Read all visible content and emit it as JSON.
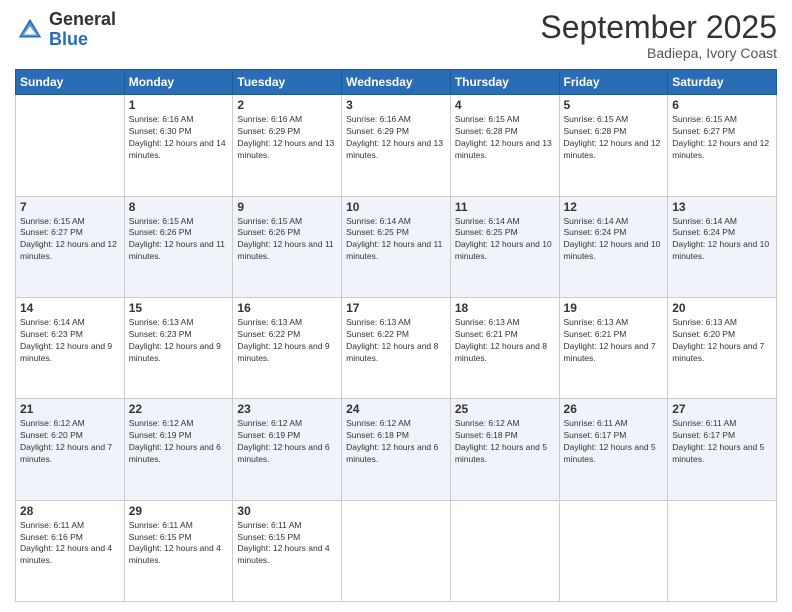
{
  "logo": {
    "general": "General",
    "blue": "Blue"
  },
  "header": {
    "month": "September 2025",
    "location": "Badiepa, Ivory Coast"
  },
  "days_of_week": [
    "Sunday",
    "Monday",
    "Tuesday",
    "Wednesday",
    "Thursday",
    "Friday",
    "Saturday"
  ],
  "weeks": [
    [
      {
        "day": "",
        "sunrise": "",
        "sunset": "",
        "daylight": ""
      },
      {
        "day": "1",
        "sunrise": "Sunrise: 6:16 AM",
        "sunset": "Sunset: 6:30 PM",
        "daylight": "Daylight: 12 hours and 14 minutes."
      },
      {
        "day": "2",
        "sunrise": "Sunrise: 6:16 AM",
        "sunset": "Sunset: 6:29 PM",
        "daylight": "Daylight: 12 hours and 13 minutes."
      },
      {
        "day": "3",
        "sunrise": "Sunrise: 6:16 AM",
        "sunset": "Sunset: 6:29 PM",
        "daylight": "Daylight: 12 hours and 13 minutes."
      },
      {
        "day": "4",
        "sunrise": "Sunrise: 6:15 AM",
        "sunset": "Sunset: 6:28 PM",
        "daylight": "Daylight: 12 hours and 13 minutes."
      },
      {
        "day": "5",
        "sunrise": "Sunrise: 6:15 AM",
        "sunset": "Sunset: 6:28 PM",
        "daylight": "Daylight: 12 hours and 12 minutes."
      },
      {
        "day": "6",
        "sunrise": "Sunrise: 6:15 AM",
        "sunset": "Sunset: 6:27 PM",
        "daylight": "Daylight: 12 hours and 12 minutes."
      }
    ],
    [
      {
        "day": "7",
        "sunrise": "Sunrise: 6:15 AM",
        "sunset": "Sunset: 6:27 PM",
        "daylight": "Daylight: 12 hours and 12 minutes."
      },
      {
        "day": "8",
        "sunrise": "Sunrise: 6:15 AM",
        "sunset": "Sunset: 6:26 PM",
        "daylight": "Daylight: 12 hours and 11 minutes."
      },
      {
        "day": "9",
        "sunrise": "Sunrise: 6:15 AM",
        "sunset": "Sunset: 6:26 PM",
        "daylight": "Daylight: 12 hours and 11 minutes."
      },
      {
        "day": "10",
        "sunrise": "Sunrise: 6:14 AM",
        "sunset": "Sunset: 6:25 PM",
        "daylight": "Daylight: 12 hours and 11 minutes."
      },
      {
        "day": "11",
        "sunrise": "Sunrise: 6:14 AM",
        "sunset": "Sunset: 6:25 PM",
        "daylight": "Daylight: 12 hours and 10 minutes."
      },
      {
        "day": "12",
        "sunrise": "Sunrise: 6:14 AM",
        "sunset": "Sunset: 6:24 PM",
        "daylight": "Daylight: 12 hours and 10 minutes."
      },
      {
        "day": "13",
        "sunrise": "Sunrise: 6:14 AM",
        "sunset": "Sunset: 6:24 PM",
        "daylight": "Daylight: 12 hours and 10 minutes."
      }
    ],
    [
      {
        "day": "14",
        "sunrise": "Sunrise: 6:14 AM",
        "sunset": "Sunset: 6:23 PM",
        "daylight": "Daylight: 12 hours and 9 minutes."
      },
      {
        "day": "15",
        "sunrise": "Sunrise: 6:13 AM",
        "sunset": "Sunset: 6:23 PM",
        "daylight": "Daylight: 12 hours and 9 minutes."
      },
      {
        "day": "16",
        "sunrise": "Sunrise: 6:13 AM",
        "sunset": "Sunset: 6:22 PM",
        "daylight": "Daylight: 12 hours and 9 minutes."
      },
      {
        "day": "17",
        "sunrise": "Sunrise: 6:13 AM",
        "sunset": "Sunset: 6:22 PM",
        "daylight": "Daylight: 12 hours and 8 minutes."
      },
      {
        "day": "18",
        "sunrise": "Sunrise: 6:13 AM",
        "sunset": "Sunset: 6:21 PM",
        "daylight": "Daylight: 12 hours and 8 minutes."
      },
      {
        "day": "19",
        "sunrise": "Sunrise: 6:13 AM",
        "sunset": "Sunset: 6:21 PM",
        "daylight": "Daylight: 12 hours and 7 minutes."
      },
      {
        "day": "20",
        "sunrise": "Sunrise: 6:13 AM",
        "sunset": "Sunset: 6:20 PM",
        "daylight": "Daylight: 12 hours and 7 minutes."
      }
    ],
    [
      {
        "day": "21",
        "sunrise": "Sunrise: 6:12 AM",
        "sunset": "Sunset: 6:20 PM",
        "daylight": "Daylight: 12 hours and 7 minutes."
      },
      {
        "day": "22",
        "sunrise": "Sunrise: 6:12 AM",
        "sunset": "Sunset: 6:19 PM",
        "daylight": "Daylight: 12 hours and 6 minutes."
      },
      {
        "day": "23",
        "sunrise": "Sunrise: 6:12 AM",
        "sunset": "Sunset: 6:19 PM",
        "daylight": "Daylight: 12 hours and 6 minutes."
      },
      {
        "day": "24",
        "sunrise": "Sunrise: 6:12 AM",
        "sunset": "Sunset: 6:18 PM",
        "daylight": "Daylight: 12 hours and 6 minutes."
      },
      {
        "day": "25",
        "sunrise": "Sunrise: 6:12 AM",
        "sunset": "Sunset: 6:18 PM",
        "daylight": "Daylight: 12 hours and 5 minutes."
      },
      {
        "day": "26",
        "sunrise": "Sunrise: 6:11 AM",
        "sunset": "Sunset: 6:17 PM",
        "daylight": "Daylight: 12 hours and 5 minutes."
      },
      {
        "day": "27",
        "sunrise": "Sunrise: 6:11 AM",
        "sunset": "Sunset: 6:17 PM",
        "daylight": "Daylight: 12 hours and 5 minutes."
      }
    ],
    [
      {
        "day": "28",
        "sunrise": "Sunrise: 6:11 AM",
        "sunset": "Sunset: 6:16 PM",
        "daylight": "Daylight: 12 hours and 4 minutes."
      },
      {
        "day": "29",
        "sunrise": "Sunrise: 6:11 AM",
        "sunset": "Sunset: 6:15 PM",
        "daylight": "Daylight: 12 hours and 4 minutes."
      },
      {
        "day": "30",
        "sunrise": "Sunrise: 6:11 AM",
        "sunset": "Sunset: 6:15 PM",
        "daylight": "Daylight: 12 hours and 4 minutes."
      },
      {
        "day": "",
        "sunrise": "",
        "sunset": "",
        "daylight": ""
      },
      {
        "day": "",
        "sunrise": "",
        "sunset": "",
        "daylight": ""
      },
      {
        "day": "",
        "sunrise": "",
        "sunset": "",
        "daylight": ""
      },
      {
        "day": "",
        "sunrise": "",
        "sunset": "",
        "daylight": ""
      }
    ]
  ]
}
